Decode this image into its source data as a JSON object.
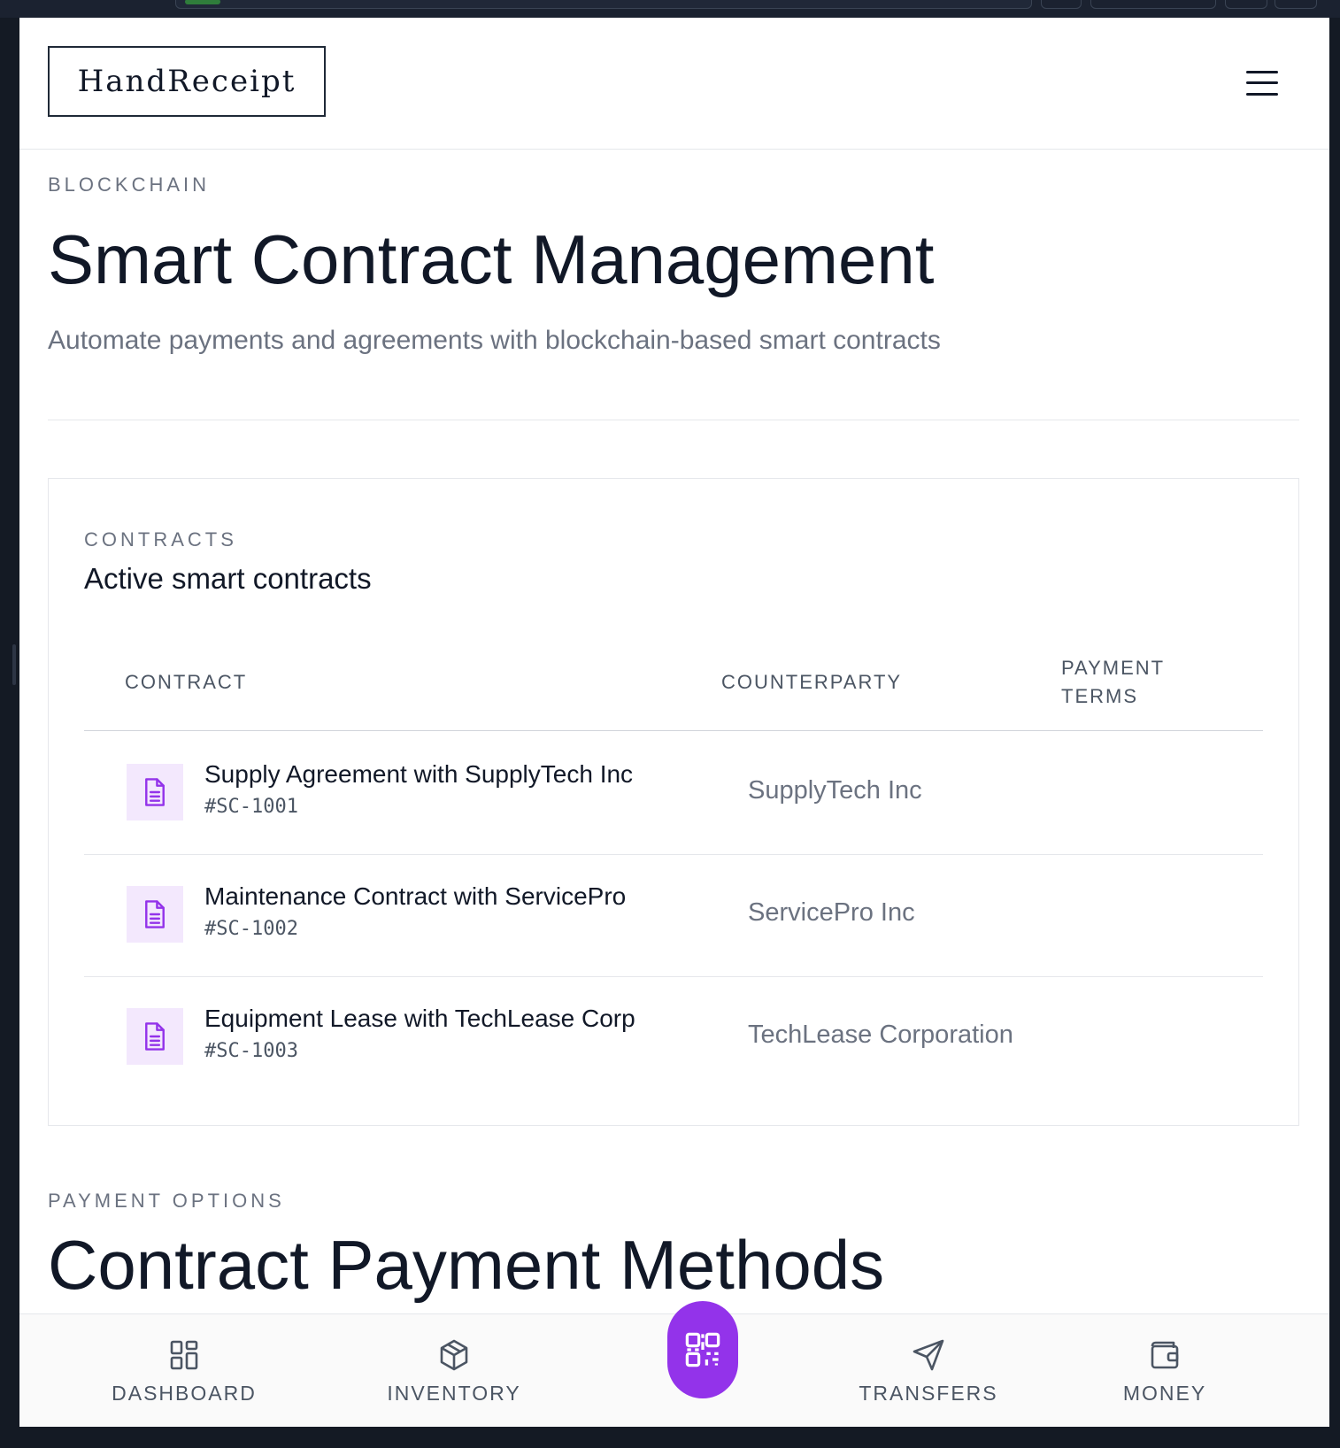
{
  "app": {
    "brand": "HandReceipt"
  },
  "header_section": {
    "eyebrow": "BLOCKCHAIN",
    "title": "Smart Contract Management",
    "subtitle": "Automate payments and agreements with blockchain-based smart contracts"
  },
  "contracts_card": {
    "eyebrow": "CONTRACTS",
    "title": "Active smart contracts",
    "columns": [
      "CONTRACT",
      "COUNTERPARTY",
      "PAYMENT",
      "TERMS"
    ],
    "rows": [
      {
        "title": "Supply Agreement with SupplyTech Inc",
        "id": "#SC-1001",
        "counterparty": "SupplyTech Inc",
        "payment_terms": ""
      },
      {
        "title": "Maintenance Contract with ServicePro",
        "id": "#SC-1002",
        "counterparty": "ServicePro Inc",
        "payment_terms": ""
      },
      {
        "title": "Equipment Lease with TechLease Corp",
        "id": "#SC-1003",
        "counterparty": "TechLease Corporation",
        "payment_terms": ""
      }
    ]
  },
  "payment_section": {
    "eyebrow": "PAYMENT OPTIONS",
    "title": "Contract Payment Methods"
  },
  "bottom_nav": {
    "items": [
      {
        "label": "DASHBOARD",
        "icon": "grid-icon"
      },
      {
        "label": "INVENTORY",
        "icon": "package-icon"
      },
      {
        "label": "",
        "icon": "qr-code-icon"
      },
      {
        "label": "TRANSFERS",
        "icon": "send-icon"
      },
      {
        "label": "MONEY",
        "icon": "wallet-icon"
      }
    ]
  },
  "colors": {
    "accent": "#9333ea",
    "accent_tint": "#f3e8fd",
    "text_primary": "#111827",
    "text_muted": "#6b7280"
  }
}
